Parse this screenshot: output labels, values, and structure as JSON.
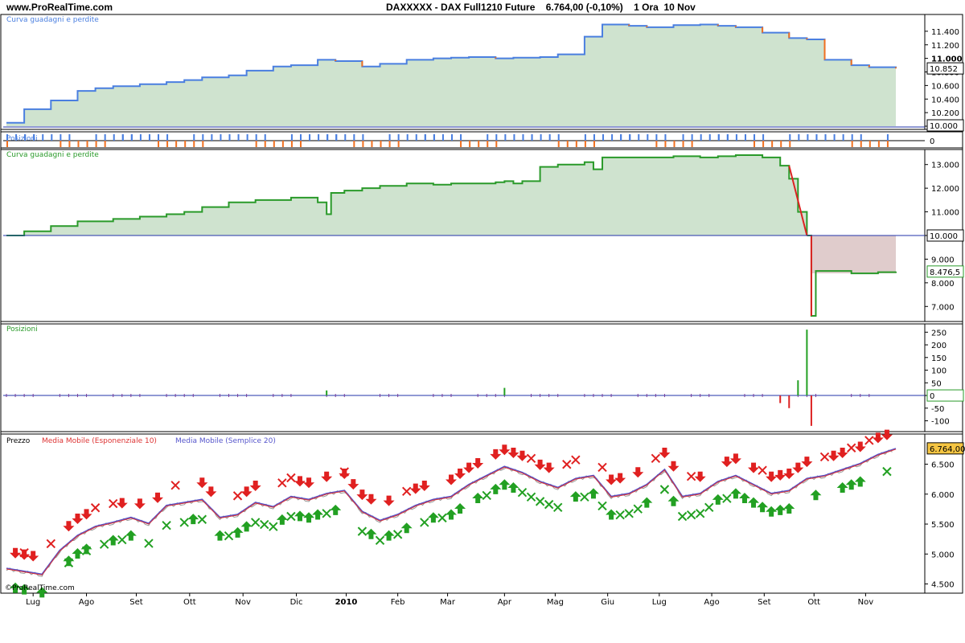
{
  "header": {
    "site": "www.ProRealTime.com",
    "instrument": "DAXXXXX - DAX Full1210 Future",
    "price_change": "6.764,00 (-0,10%)",
    "timeframe": "1 Ora",
    "date": "10 Nov"
  },
  "watermark": "©ProRealTime.com",
  "colors": {
    "equity_fill": "#cfe3cf",
    "equity_line_up": "#4a7fe0",
    "equity_line_down": "#f07020",
    "equity2_line": "#2a9a2a",
    "loss_fill": "#e0cccc",
    "loss_line": "#dd2222",
    "ema": "#dd3333",
    "sma": "#5555cc",
    "buy": "#22a022",
    "sell": "#e02020"
  },
  "x_axis": {
    "labels": [
      "Lug",
      "Ago",
      "Set",
      "Ott",
      "Nov",
      "Dic",
      "2010",
      "Feb",
      "Mar",
      "Apr",
      "Mag",
      "Giu",
      "Lug",
      "Ago",
      "Set",
      "Ott",
      "Nov"
    ]
  },
  "chart_data": [
    {
      "type": "area",
      "title": "Curva guadagni e perdite",
      "ylim": [
        10000,
        11600
      ],
      "yticks": [
        "10.000",
        "10.200",
        "10.400",
        "10.600",
        "10.800",
        "11.000",
        "11.200",
        "11.400"
      ],
      "last_value_label": "10.852",
      "highlight_tick": "11.000",
      "x": [
        0,
        2,
        5,
        8,
        10,
        12,
        15,
        18,
        20,
        22,
        25,
        27,
        30,
        32,
        35,
        37,
        40,
        42,
        45,
        48,
        50,
        52,
        55,
        57,
        60,
        62,
        65,
        67,
        70,
        72,
        75,
        78,
        80,
        82,
        85,
        88,
        90,
        92,
        95,
        97,
        100
      ],
      "values": [
        10050,
        10250,
        10380,
        10520,
        10560,
        10590,
        10620,
        10650,
        10680,
        10720,
        10750,
        10820,
        10880,
        10900,
        10980,
        10960,
        10880,
        10920,
        10980,
        11000,
        11010,
        11020,
        11000,
        11010,
        11020,
        11060,
        11320,
        11500,
        11480,
        11460,
        11490,
        11500,
        11480,
        11460,
        11380,
        11300,
        11280,
        10980,
        10900,
        10870,
        10852
      ]
    },
    {
      "type": "bar",
      "title": "Posizioni",
      "ylim": [
        -130,
        270
      ],
      "yticks": [
        "-100",
        "-50",
        "0",
        "50",
        "100",
        "150",
        "200",
        "250"
      ],
      "last_value_label": "0",
      "spikes": [
        [
          36,
          20
        ],
        [
          56,
          30
        ],
        [
          87,
          -30
        ],
        [
          89,
          60
        ],
        [
          90,
          260
        ],
        [
          90.5,
          -120
        ],
        [
          88,
          -50
        ]
      ]
    },
    {
      "type": "area",
      "title": "Curva guadagni e perdite",
      "ylim": [
        6500,
        13500
      ],
      "yticks": [
        "7.000",
        "8.000",
        "9.000",
        "10.000",
        "11.000",
        "12.000",
        "13.000"
      ],
      "last_value_label": "8.476,5",
      "zero_label": "10.000",
      "x": [
        0,
        2,
        5,
        8,
        12,
        15,
        18,
        20,
        22,
        25,
        28,
        30,
        32,
        35,
        36,
        36.5,
        38,
        40,
        42,
        45,
        48,
        50,
        52,
        55,
        56,
        57,
        58,
        60,
        62,
        65,
        66,
        67,
        68,
        70,
        72,
        75,
        78,
        80,
        82,
        85,
        87,
        88,
        89,
        90,
        90.5,
        91,
        95,
        98,
        100
      ],
      "values": [
        10000,
        10180,
        10400,
        10600,
        10700,
        10800,
        10900,
        11000,
        11200,
        11400,
        11500,
        11500,
        11600,
        11400,
        10900,
        11800,
        11900,
        12000,
        12100,
        12200,
        12150,
        12200,
        12200,
        12250,
        12300,
        12200,
        12300,
        12900,
        13000,
        13100,
        12800,
        13300,
        13300,
        13300,
        13300,
        13350,
        13300,
        13350,
        13400,
        13300,
        12950,
        12400,
        11000,
        10000,
        6600,
        8500,
        8400,
        8450,
        8476
      ]
    },
    {
      "type": "line",
      "title": "Prezzo",
      "legend": [
        "Media Mobile (Esponenziale 10)",
        "Media Mobile (Semplice 20)"
      ],
      "ylim": [
        4400,
        6950
      ],
      "yticks": [
        "4.500",
        "5.000",
        "5.500",
        "6.000",
        "6.500"
      ],
      "last_value_label": "6.764,00",
      "x": [
        0,
        2,
        4,
        6,
        8,
        10,
        12,
        14,
        16,
        18,
        20,
        22,
        24,
        26,
        28,
        30,
        32,
        34,
        36,
        38,
        40,
        42,
        44,
        46,
        48,
        50,
        52,
        54,
        56,
        58,
        60,
        62,
        64,
        66,
        68,
        70,
        72,
        74,
        76,
        78,
        80,
        82,
        84,
        86,
        88,
        90,
        92,
        94,
        96,
        98,
        100
      ],
      "values": [
        4750,
        4700,
        4650,
        5050,
        5300,
        5450,
        5520,
        5600,
        5500,
        5800,
        5850,
        5900,
        5600,
        5650,
        5850,
        5780,
        5950,
        5900,
        6000,
        6050,
        5700,
        5550,
        5650,
        5800,
        5900,
        5950,
        6150,
        6300,
        6450,
        6350,
        6200,
        6100,
        6250,
        6300,
        5950,
        6000,
        6150,
        6400,
        5950,
        6000,
        6200,
        6300,
        6150,
        6000,
        6050,
        6250,
        6300,
        6400,
        6500,
        6650,
        6750
      ]
    }
  ],
  "signals": {
    "sell_arrows": [
      1,
      2,
      3,
      7,
      8,
      9,
      13,
      15,
      17,
      22,
      23,
      27,
      28,
      33,
      34,
      36,
      38,
      39,
      40,
      41,
      43,
      46,
      47,
      50,
      51,
      52,
      53,
      55,
      56,
      57,
      58,
      60,
      61,
      68,
      69,
      71,
      74,
      75,
      78,
      81,
      82,
      84,
      86,
      87,
      88,
      89,
      90,
      93,
      94,
      96,
      98,
      99
    ],
    "sell_x": [
      2,
      5,
      10,
      12,
      19,
      26,
      31,
      32,
      38,
      45,
      59,
      63,
      64,
      67,
      73,
      77,
      85,
      92,
      95,
      97
    ],
    "buy_arrows": [
      1,
      2,
      4,
      7,
      8,
      9,
      12,
      14,
      21,
      24,
      26,
      27,
      31,
      33,
      34,
      35,
      37,
      41,
      43,
      45,
      48,
      50,
      51,
      53,
      55,
      56,
      57,
      64,
      66,
      68,
      72,
      75,
      80,
      82,
      83,
      84,
      85,
      86,
      87,
      88,
      91,
      94,
      95,
      96
    ],
    "buy_x": [
      7,
      9,
      11,
      13,
      16,
      18,
      20,
      22,
      25,
      28,
      29,
      30,
      32,
      36,
      40,
      42,
      44,
      47,
      49,
      54,
      58,
      59,
      60,
      61,
      62,
      65,
      67,
      69,
      70,
      71,
      74,
      76,
      77,
      78,
      79,
      81,
      99
    ]
  }
}
